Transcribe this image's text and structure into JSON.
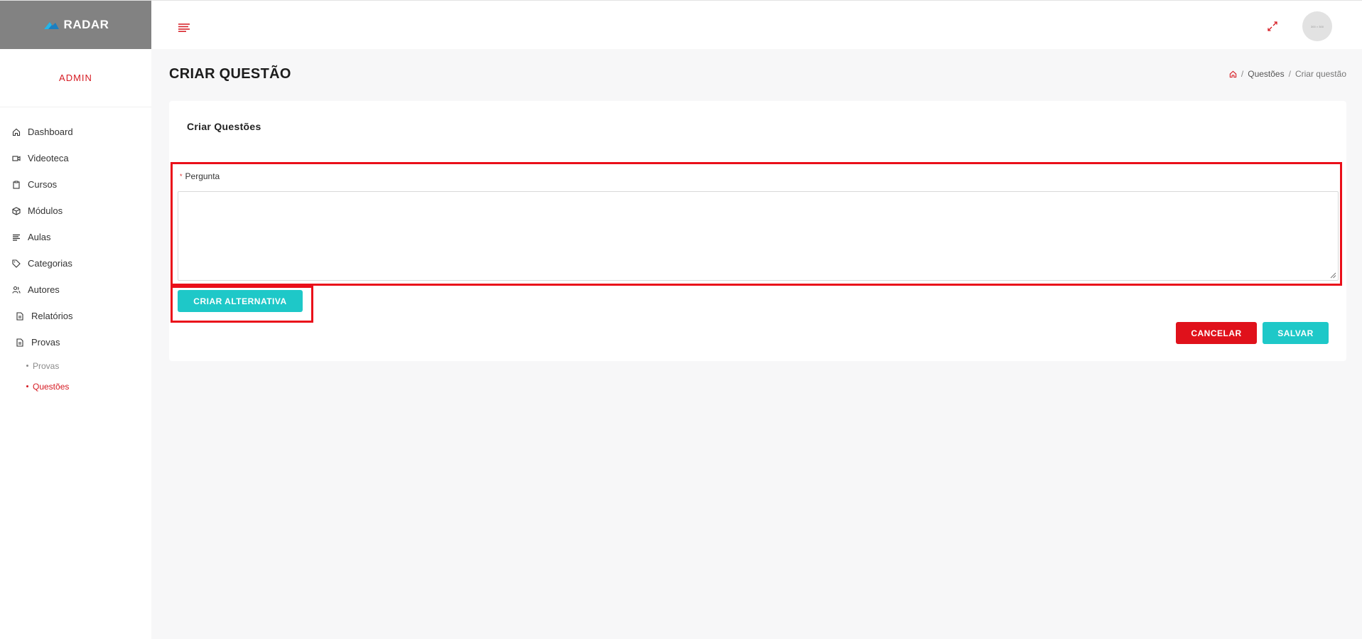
{
  "app": {
    "brand_name": "RADAR",
    "user_role": "ADMIN",
    "avatar_text": "300 × 300"
  },
  "colors": {
    "accent_red": "#d61a22",
    "teal": "#1ec8c8",
    "sidebar_header_bg": "#828282",
    "highlight": "#ea0f1a"
  },
  "sidebar": {
    "items": [
      {
        "label": "Dashboard",
        "icon": "home-icon"
      },
      {
        "label": "Videoteca",
        "icon": "video-icon"
      },
      {
        "label": "Cursos",
        "icon": "clipboard-icon"
      },
      {
        "label": "Módulos",
        "icon": "box-icon"
      },
      {
        "label": "Aulas",
        "icon": "align-left-icon"
      },
      {
        "label": "Categorias",
        "icon": "tag-icon"
      },
      {
        "label": "Autores",
        "icon": "users-icon"
      },
      {
        "label": "Relatórios",
        "icon": "file-icon"
      },
      {
        "label": "Provas",
        "icon": "file-icon"
      }
    ],
    "sub_items": [
      {
        "label": "Provas",
        "active": false
      },
      {
        "label": "Questões",
        "active": true
      }
    ]
  },
  "header": {
    "title": "CRIAR QUESTÃO",
    "breadcrumb": {
      "home_icon": "home-icon",
      "items": [
        "Questões",
        "Criar questão"
      ]
    }
  },
  "form": {
    "card_title": "Criar Questões",
    "question_label": "Pergunta",
    "required_marker": "*",
    "question_value": "",
    "create_alternative_label": "CRIAR ALTERNATIVA",
    "cancel_label": "CANCELAR",
    "save_label": "SALVAR"
  }
}
